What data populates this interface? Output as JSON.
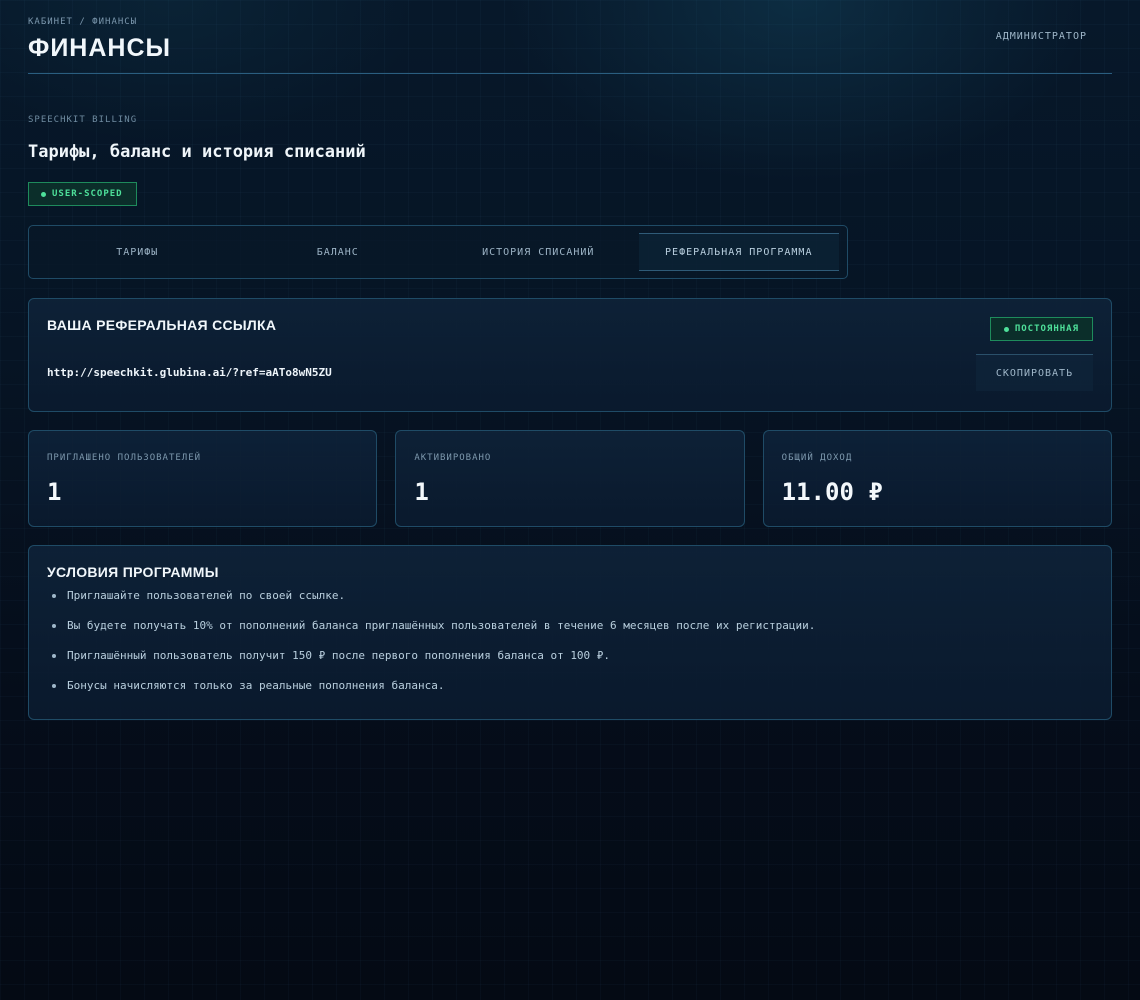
{
  "header": {
    "breadcrumb": "КАБИНЕТ / ФИНАНСЫ",
    "title": "ФИНАНСЫ",
    "user_role": "АДМИНИСТРАТОР"
  },
  "section": {
    "eyebrow": "SPEECHKIT BILLING",
    "title": "Тарифы, баланс и история списаний",
    "scope_badge": "USER-SCOPED"
  },
  "tabs": [
    {
      "label": "ТАРИФЫ",
      "active": false
    },
    {
      "label": "БАЛАНС",
      "active": false
    },
    {
      "label": "ИСТОРИЯ СПИСАНИЙ",
      "active": false
    },
    {
      "label": "РЕФЕРАЛЬНАЯ ПРОГРАММА",
      "active": true
    }
  ],
  "referral": {
    "title": "ВАША РЕФЕРАЛЬНАЯ ССЫЛКА",
    "badge": "ПОСТОЯННАЯ",
    "link": "http://speechkit.glubina.ai/?ref=aATo8wN5ZU",
    "copy_label": "СКОПИРОВАТЬ"
  },
  "stats": [
    {
      "label": "ПРИГЛАШЕНО ПОЛЬЗОВАТЕЛЕЙ",
      "value": "1"
    },
    {
      "label": "АКТИВИРОВАНО",
      "value": "1"
    },
    {
      "label": "ОБЩИЙ ДОХОД",
      "value": "11.00 ₽"
    }
  ],
  "terms": {
    "title": "УСЛОВИЯ ПРОГРАММЫ",
    "items": [
      "Приглашайте пользователей по своей ссылке.",
      "Вы будете получать 10% от пополнений баланса приглашённых пользователей в течение 6 месяцев после их регистрации.",
      "Приглашённый пользователь получит 150 ₽ после первого пополнения баланса от 100 ₽.",
      "Бонусы начисляются только за реальные пополнения баланса."
    ]
  },
  "colors": {
    "accent_green": "#4ee09a",
    "border_blue": "#1f4b66",
    "background": "#061424"
  }
}
